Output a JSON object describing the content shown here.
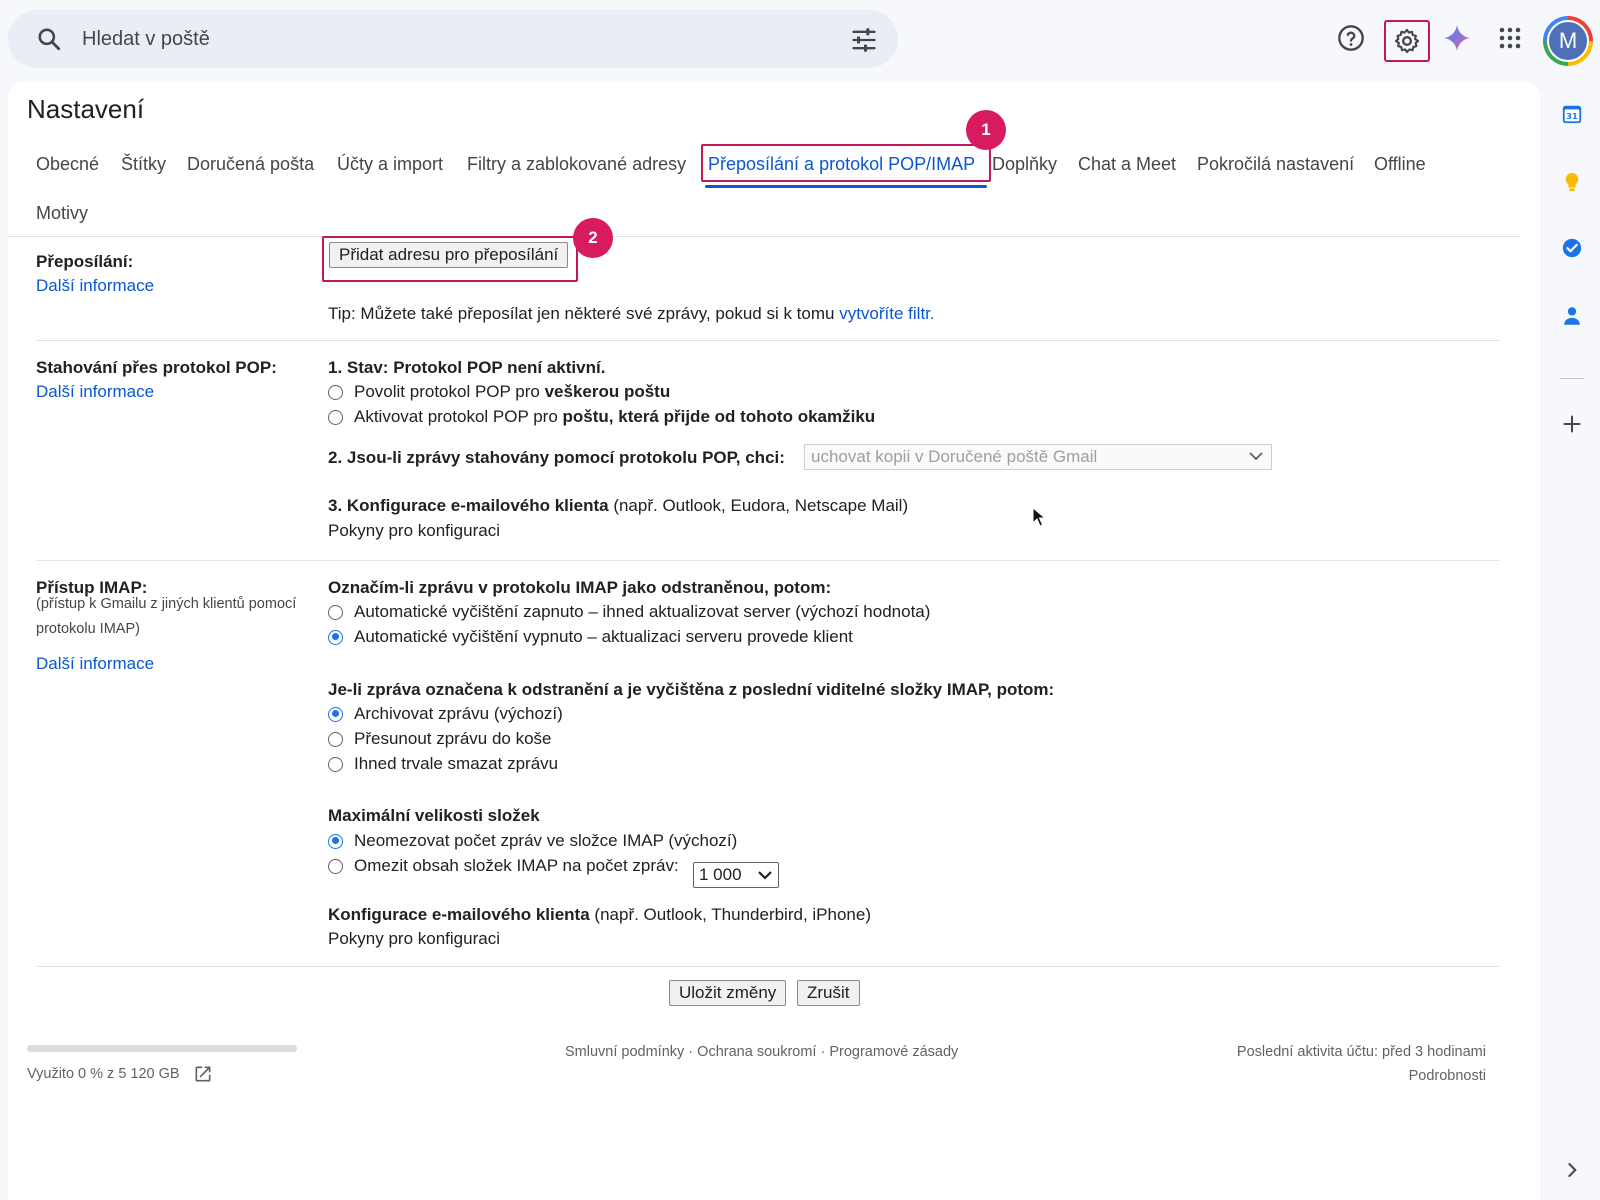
{
  "search": {
    "placeholder": "Hledat v poště"
  },
  "account": {
    "avatar_letter": "M"
  },
  "page_title": "Nastavení",
  "tabs": [
    {
      "label": "Obecné"
    },
    {
      "label": "Štítky"
    },
    {
      "label": "Doručená pošta"
    },
    {
      "label": "Účty a import"
    },
    {
      "label": "Filtry a zablokované adresy"
    },
    {
      "label": "Přeposílání a protokol POP/IMAP",
      "active": true
    },
    {
      "label": "Doplňky"
    },
    {
      "label": "Chat a Meet"
    },
    {
      "label": "Pokročilá nastavení"
    },
    {
      "label": "Offline"
    },
    {
      "label": "Motivy"
    }
  ],
  "badges": {
    "one": "1",
    "two": "2"
  },
  "forwarding": {
    "label": "Přeposílání:",
    "more_info": "Další informace",
    "add_button": "Přidat adresu pro přeposílání",
    "tip_prefix": "Tip: Můžete také přeposílat jen některé své zprávy, pokud si k tomu",
    "tip_link": "vytvoříte filtr."
  },
  "pop": {
    "label": "Stahování přes protokol POP:",
    "more_info": "Další informace",
    "status": "1. Stav: Protokol POP není aktivní.",
    "opt1_prefix": "Povolit protokol POP pro",
    "opt1_bold": "veškerou poštu",
    "opt2_prefix": "Aktivovat protokol POP pro",
    "opt2_bold": "poštu, která přijde od tohoto okamžiku",
    "when_label": "2. Jsou-li zprávy stahovány pomocí protokolu POP, chci:",
    "when_value": "uchovat kopii v Doručené poště Gmail",
    "client_bold": "3. Konfigurace e-mailového klienta",
    "client_rest": "(např. Outlook, Eudora, Netscape Mail)",
    "config_link": "Pokyny pro konfiguraci"
  },
  "imap": {
    "label": "Přístup IMAP:",
    "note": "(přístup k Gmailu z jiných klientů pomocí protokolu IMAP)",
    "more_info": "Další informace",
    "deleted_heading": "Označím-li zprávu v protokolu IMAP jako odstraněnou, potom:",
    "deleted_opt1": "Automatické vyčištění zapnuto – ihned aktualizovat server (výchozí hodnota)",
    "deleted_opt2": "Automatické vyčištění vypnuto – aktualizaci serveru provede klient",
    "expunge_heading": "Je-li zpráva označena k odstranění a je vyčištěna z poslední viditelné složky IMAP, potom:",
    "expunge_opt1": "Archivovat zprávu (výchozí)",
    "expunge_opt2": "Přesunout zprávu do koše",
    "expunge_opt3": "Ihned trvale smazat zprávu",
    "size_heading": "Maximální velikosti složek",
    "size_opt1": "Neomezovat počet zpráv ve složce IMAP (výchozí)",
    "size_opt2": "Omezit obsah složek IMAP na počet zpráv:",
    "size_limit": "1 000",
    "client_bold": "Konfigurace e-mailového klienta",
    "client_rest": "(např. Outlook, Thunderbird, iPhone)",
    "config_link": "Pokyny pro konfiguraci"
  },
  "actions": {
    "save": "Uložit změny",
    "cancel": "Zrušit"
  },
  "footer": {
    "storage_text": "Využito 0 % z 5 120 GB",
    "storage_used_fraction": 0.0,
    "terms": "Smluvní podmínky",
    "privacy": "Ochrana soukromí",
    "policies": "Programové zásady",
    "separator": " · ",
    "last_activity": "Poslední aktivita účtu: před 3 hodinami",
    "details": "Podrobnosti"
  },
  "colors": {
    "accent": "#0b57d0",
    "highlight": "#c2185b",
    "badge": "#d81b60"
  }
}
